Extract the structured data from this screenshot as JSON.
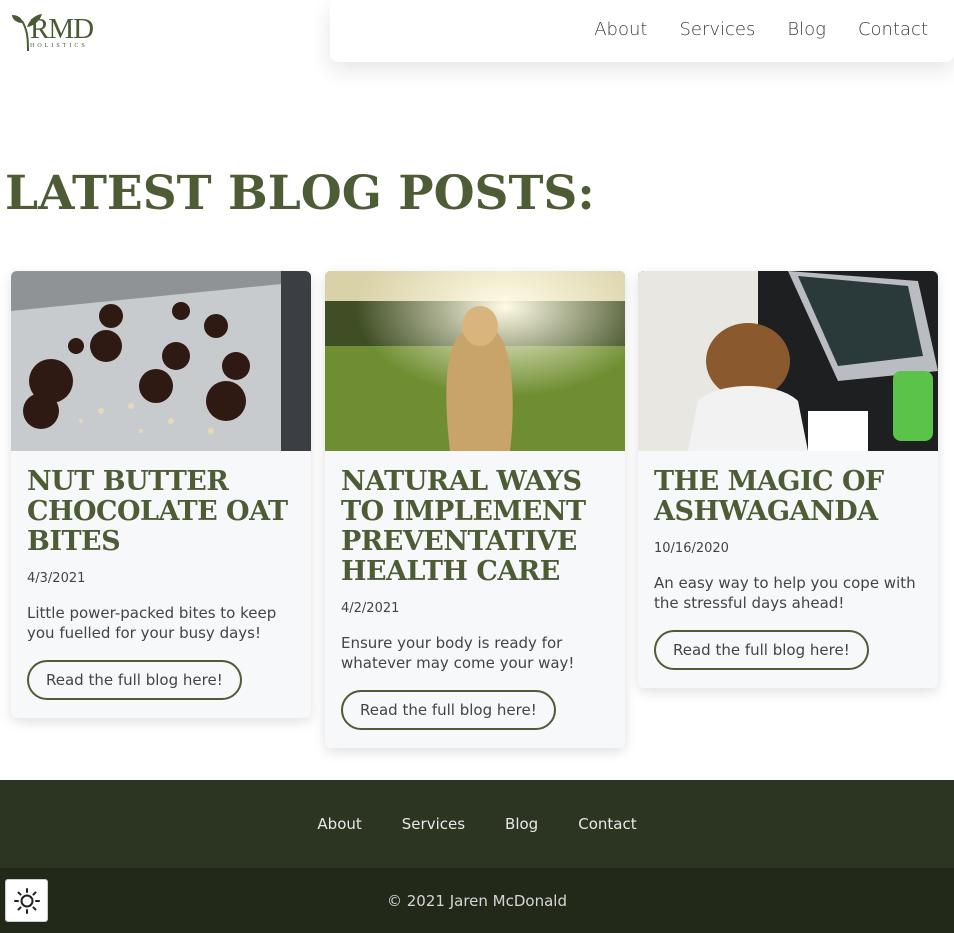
{
  "brand": {
    "logo_text": "RMD",
    "logo_sub": "HOLISTICS",
    "accent": "#4e5c36"
  },
  "nav": {
    "items": [
      "About",
      "Services",
      "Blog",
      "Contact"
    ]
  },
  "page_title": "LATEST BLOG POSTS:",
  "posts": [
    {
      "title": "NUT BUTTER CHOCOLATE OAT BITES",
      "date": "4/3/2021",
      "description": "Little power-packed bites to keep you fuelled for your busy days!",
      "button": "Read the full blog here!"
    },
    {
      "title": "NATURAL WAYS TO IMPLEMENT PREVENTATIVE HEALTH CARE",
      "date": "4/2/2021",
      "description": "Ensure your body is ready for whatever may come your way!",
      "button": "Read the full blog here!"
    },
    {
      "title": "THE MAGIC OF ASHWAGANDA",
      "date": "10/16/2020",
      "description": "An easy way to help you cope with the stressful days ahead!",
      "button": "Read the full blog here!"
    }
  ],
  "footer": {
    "nav": [
      "About",
      "Services",
      "Blog",
      "Contact"
    ],
    "copyright": "© 2021 Jaren McDonald"
  },
  "theme_toggle_icon": "sun-icon"
}
